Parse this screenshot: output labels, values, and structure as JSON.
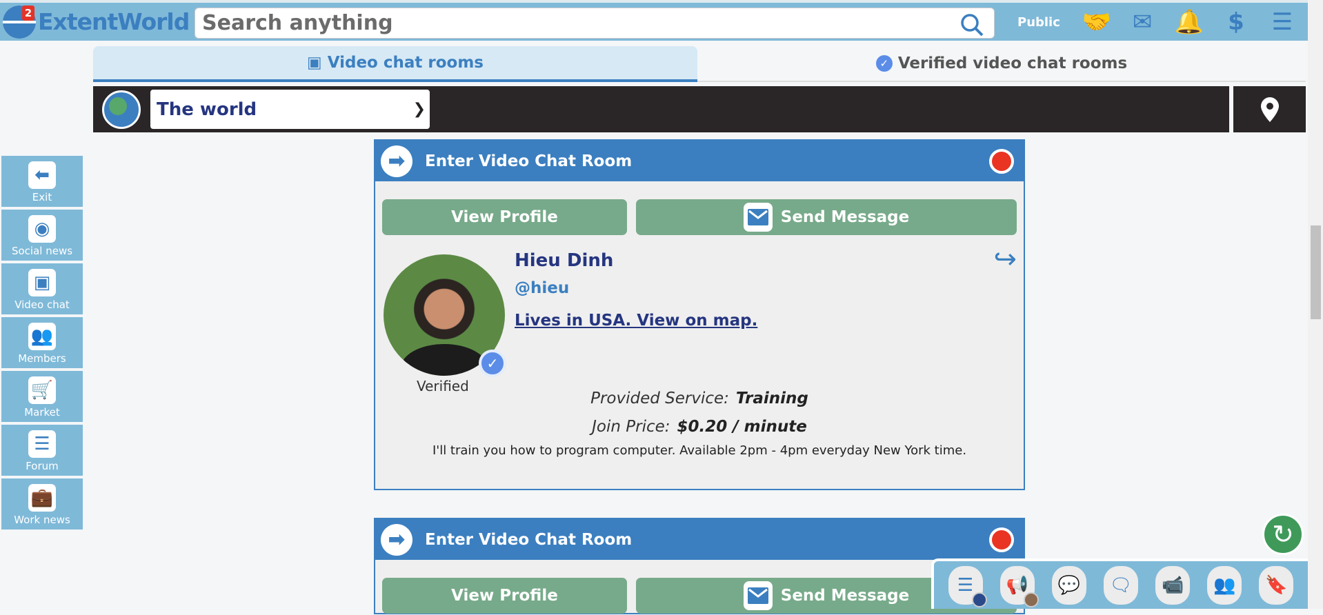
{
  "header": {
    "brand": "ExtentWorld",
    "notification_count": "2",
    "search_placeholder": "Search anything",
    "visibility": "Public",
    "icons": [
      "handshake-icon",
      "mail-icon",
      "bell-icon",
      "dollar-icon",
      "menu-icon"
    ]
  },
  "tabs": [
    {
      "label": "Video chat rooms",
      "active": true
    },
    {
      "label": "Verified video chat rooms",
      "active": false
    }
  ],
  "location": {
    "selected": "The world"
  },
  "sidebar": [
    {
      "label": "Exit",
      "icon": "arrow-left-icon"
    },
    {
      "label": "Social news",
      "icon": "rss-icon"
    },
    {
      "label": "Video chat",
      "icon": "video-chat-icon"
    },
    {
      "label": "Members",
      "icon": "members-icon"
    },
    {
      "label": "Market",
      "icon": "cart-icon"
    },
    {
      "label": "Forum",
      "icon": "forum-icon"
    },
    {
      "label": "Work news",
      "icon": "briefcase-icon"
    }
  ],
  "cards": [
    {
      "title": "Enter Video Chat Room",
      "view_profile": "View Profile",
      "send_message": "Send Message",
      "name": "Hieu Dinh",
      "handle": "@hieu",
      "location_link": "Lives in USA. View on map.",
      "verified_label": "Verified",
      "service_label": "Provided Service:",
      "service_value": "Training",
      "price_label": "Join Price:",
      "price_value": "$0.20 / minute",
      "description": "I'll train you how to program computer. Available 2pm - 4pm everyday New York time."
    },
    {
      "title": "Enter Video Chat Room",
      "view_profile": "View Profile",
      "send_message": "Send Message"
    }
  ],
  "dock": [
    "menu-world-icon",
    "announcement-icon",
    "group-chat-icon",
    "chat-icon",
    "video-call-icon",
    "groups-icon",
    "bookmark-icon"
  ],
  "colors": {
    "header": "#7fb9d8",
    "accent": "#3b7fc0",
    "button": "#77aa8a",
    "record": "#e93424",
    "refresh": "#3f9a5a"
  }
}
